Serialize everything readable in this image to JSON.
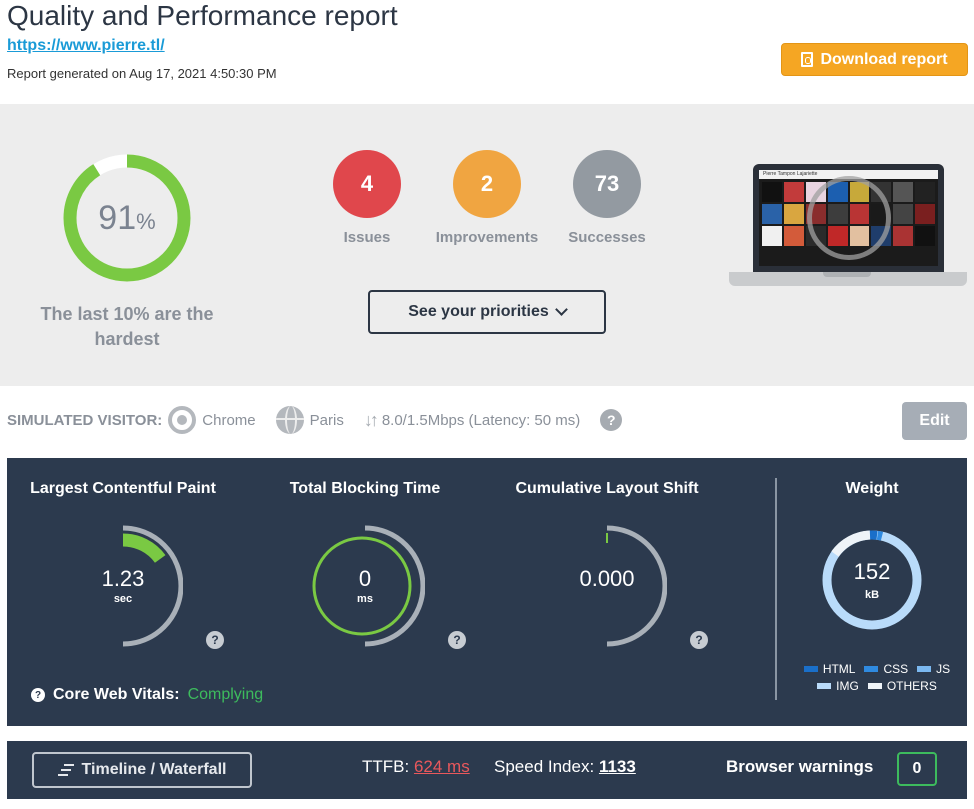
{
  "header": {
    "title": "Quality and Performance report",
    "url": "https://www.pierre.tl/",
    "generated": "Report generated on Aug 17, 2021 4:50:30 PM",
    "download_label": "Download report"
  },
  "summary": {
    "score": "91",
    "score_unit": "%",
    "score_fraction": 0.91,
    "tagline": "The last 10% are the hardest",
    "counters": [
      {
        "value": "4",
        "label": "Issues",
        "color": "#e0474c"
      },
      {
        "value": "2",
        "label": "Improvements",
        "color": "#f0a541"
      },
      {
        "value": "73",
        "label": "Successes",
        "color": "#939aa1"
      }
    ],
    "priorities_label": "See your priorities",
    "preview_site_title": "Pierre Tampon Lajariette"
  },
  "visitor": {
    "label": "SIMULATED VISITOR:",
    "browser": "Chrome",
    "location": "Paris",
    "connection": "8.0/1.5Mbps (Latency: 50 ms)",
    "edit_label": "Edit"
  },
  "metrics": {
    "lcp": {
      "title": "Largest Contentful Paint",
      "value": "1.23",
      "unit": "sec",
      "fill_fraction": 0.3
    },
    "tbt": {
      "title": "Total Blocking Time",
      "value": "0",
      "unit": "ms",
      "fill_fraction": 0.0
    },
    "cls": {
      "title": "Cumulative Layout Shift",
      "value": "0.000",
      "unit": "",
      "fill_fraction": 0.0
    },
    "weight": {
      "title": "Weight",
      "value": "152",
      "unit": "kB",
      "legend": [
        {
          "name": "HTML",
          "color": "#1a6fc9"
        },
        {
          "name": "CSS",
          "color": "#2f8ae0"
        },
        {
          "name": "JS",
          "color": "#7bb8f0"
        },
        {
          "name": "IMG",
          "color": "#b9dbfa"
        },
        {
          "name": "OTHERS",
          "color": "#eef3f8"
        }
      ]
    },
    "cwv_label": "Core Web Vitals:",
    "cwv_status": "Complying"
  },
  "bottom": {
    "timeline_label": "Timeline / Waterfall",
    "ttfb_label": "TTFB:",
    "ttfb_value": "624 ms",
    "speed_index_label": "Speed Index:",
    "speed_index_value": "1133",
    "browser_warnings_label": "Browser warnings",
    "browser_warnings_count": "0"
  },
  "colors": {
    "accent_orange": "#f5a623",
    "good_green": "#7ac943",
    "panel": "#2c3a4e",
    "link_blue": "#1a9bd7",
    "ttfb_red": "#e9585c"
  }
}
